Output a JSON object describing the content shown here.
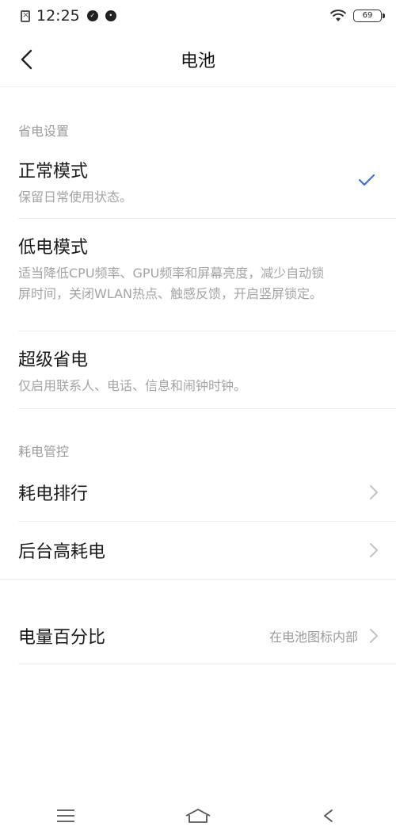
{
  "status_bar": {
    "time": "12:25",
    "battery_level": "69",
    "icons": [
      "sim-off-icon",
      "notification-icon",
      "app-notification-icon",
      "wifi-icon",
      "battery-icon"
    ]
  },
  "header": {
    "title": "电池",
    "back_icon": "back-chevron-icon"
  },
  "sections": {
    "power_saving": {
      "label": "省电设置",
      "items": [
        {
          "title": "正常模式",
          "desc": "保留日常使用状态。",
          "selected": true
        },
        {
          "title": "低电模式",
          "desc": "适当降低CPU频率、GPU频率和屏幕亮度，减少自动锁屏时间，关闭WLAN热点、触感反馈，开启竖屏锁定。",
          "selected": false
        },
        {
          "title": "超级省电",
          "desc": "仅启用联系人、电话、信息和闹钟时钟。",
          "selected": false
        }
      ]
    },
    "consumption": {
      "label": "耗电管控",
      "items": [
        {
          "title": "耗电排行"
        },
        {
          "title": "后台高耗电"
        }
      ]
    },
    "percentage": {
      "title": "电量百分比",
      "value": "在电池图标内部"
    }
  },
  "colors": {
    "accent": "#3f6fd8",
    "secondary_text": "#9b9b9b",
    "divider": "#ececec"
  }
}
